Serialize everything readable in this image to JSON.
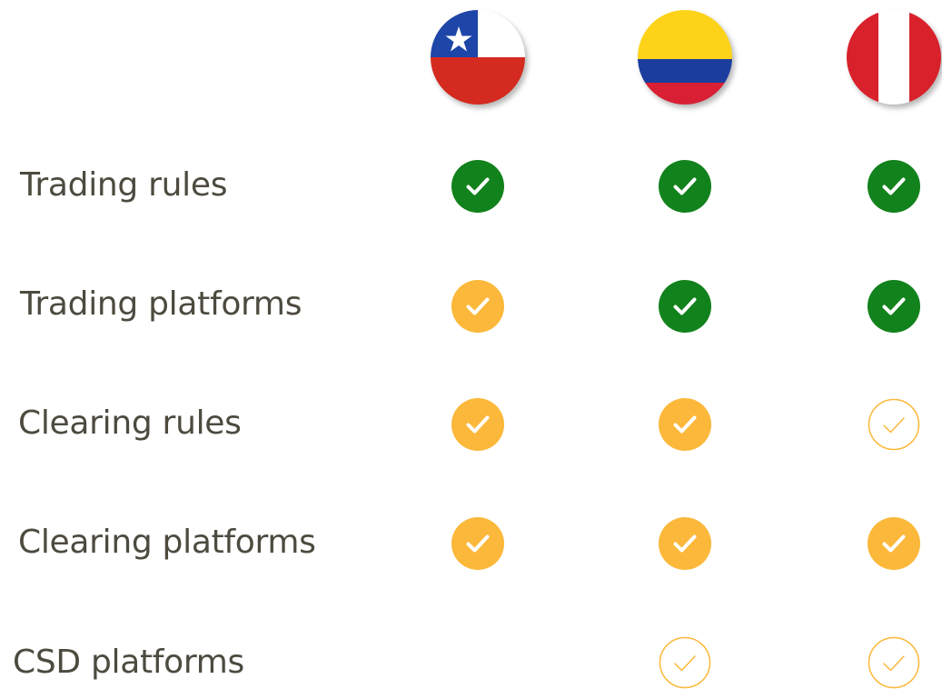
{
  "colors": {
    "full": "#12821c",
    "partial": "#fbb83a",
    "planned": "#fbb83a",
    "label_text": "#4d4a3f"
  },
  "countries": [
    {
      "name": "Chile",
      "flag_icon": "chile-flag-icon"
    },
    {
      "name": "Colombia",
      "flag_icon": "colombia-flag-icon"
    },
    {
      "name": "Peru",
      "flag_icon": "peru-flag-icon"
    }
  ],
  "rows": [
    {
      "label": "Trading rules",
      "status": [
        "full",
        "full",
        "full"
      ]
    },
    {
      "label": "Trading platforms",
      "status": [
        "partial",
        "full",
        "full"
      ]
    },
    {
      "label": "Clearing rules",
      "status": [
        "partial",
        "partial",
        "planned"
      ]
    },
    {
      "label": "Clearing platforms",
      "status": [
        "partial",
        "partial",
        "partial"
      ]
    },
    {
      "label": "CSD platforms",
      "status": [
        "none",
        "planned",
        "planned"
      ]
    }
  ]
}
